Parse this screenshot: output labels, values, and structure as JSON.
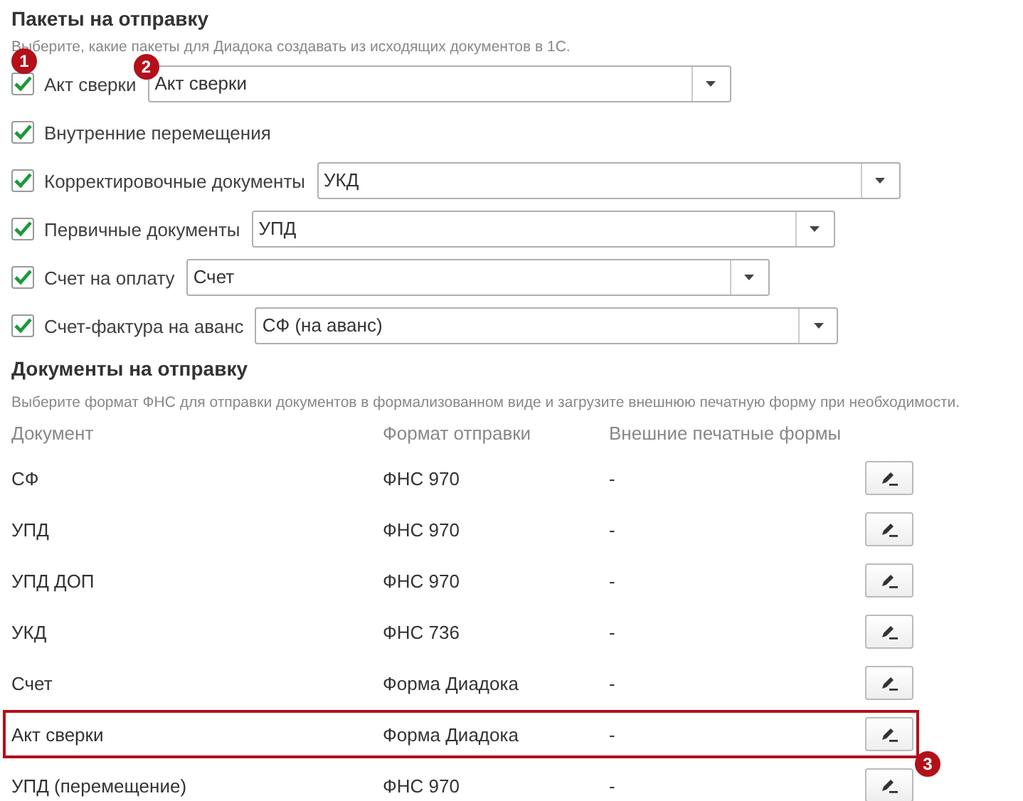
{
  "packages_section": {
    "title": "Пакеты на отправку",
    "hint": "Выберите, какие пакеты для Диадока создавать из исходящих документов в 1С.",
    "items": [
      {
        "kind": "combo",
        "label": "Акт сверки",
        "checked": true,
        "value": "Акт сверки",
        "checkbox_callout": "1",
        "field_callout": "2"
      },
      {
        "kind": "plain",
        "label": "Внутренние перемещения",
        "checked": true
      },
      {
        "kind": "combo",
        "label": "Корректировочные документы",
        "checked": true,
        "value": "УКД"
      },
      {
        "kind": "combo",
        "label": "Первичные документы",
        "checked": true,
        "value": "УПД"
      },
      {
        "kind": "combo",
        "label": "Счет на оплату",
        "checked": true,
        "value": "Счет"
      },
      {
        "kind": "combo",
        "label": "Счет-фактура на аванс",
        "checked": true,
        "value": "СФ (на аванс)"
      }
    ]
  },
  "documents_section": {
    "title": "Документы на отправку",
    "hint": "Выберите формат ФНС для отправки документов в формализованном виде и загрузите внешнюю печатную форму при необходимости.",
    "columns": [
      "Документ",
      "Формат отправки",
      "Внешние печатные формы"
    ],
    "rows": [
      {
        "document": "СФ",
        "format": "ФНС 970",
        "print_forms": "-",
        "highlighted": false
      },
      {
        "document": "УПД",
        "format": "ФНС 970",
        "print_forms": "-",
        "highlighted": false
      },
      {
        "document": "УПД ДОП",
        "format": "ФНС 970",
        "print_forms": "-",
        "highlighted": false
      },
      {
        "document": "УКД",
        "format": "ФНС 736",
        "print_forms": "-",
        "highlighted": false
      },
      {
        "document": "Счет",
        "format": "Форма Диадока",
        "print_forms": "-",
        "highlighted": false
      },
      {
        "document": "Акт сверки",
        "format": "Форма Диадока",
        "print_forms": "-",
        "highlighted": true,
        "callout": "3"
      },
      {
        "document": "УПД (перемещение)",
        "format": "ФНС 970",
        "print_forms": "-",
        "highlighted": false
      }
    ]
  }
}
